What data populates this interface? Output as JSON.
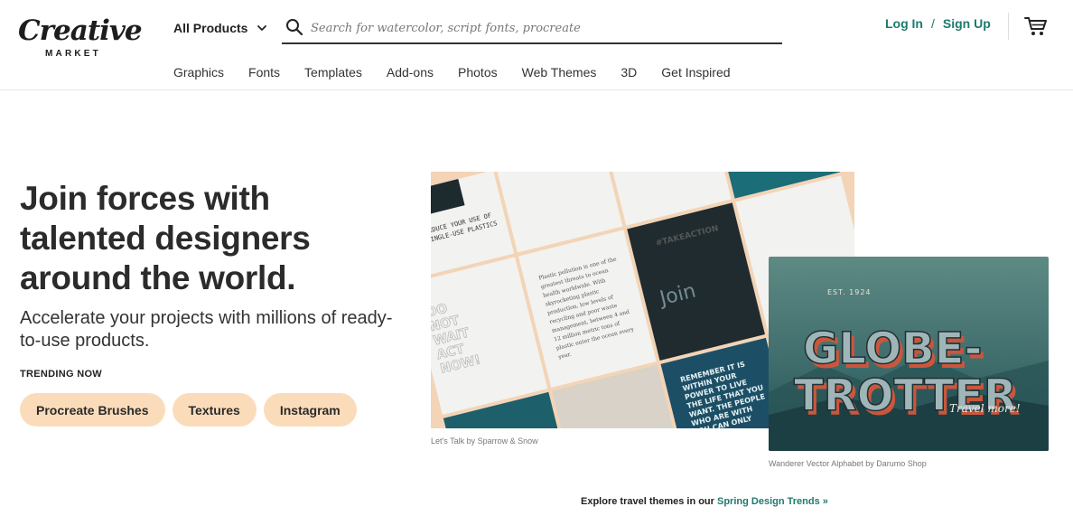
{
  "brand": {
    "logo_word": "Creative",
    "logo_sub": "MARKET"
  },
  "search": {
    "category": "All Products",
    "placeholder": "Search for watercolor, script fonts, procreate"
  },
  "nav": [
    "Graphics",
    "Fonts",
    "Templates",
    "Add-ons",
    "Photos",
    "Web Themes",
    "3D",
    "Get Inspired"
  ],
  "auth": {
    "login": "Log In",
    "separator": "/",
    "signup": "Sign Up"
  },
  "hero": {
    "headline": "Join forces with talented designers around the world.",
    "subhead": "Accelerate your projects with millions of ready-to-use products.",
    "trending_label": "TRENDING NOW",
    "chips": [
      "Procreate Brushes",
      "Textures",
      "Instagram"
    ]
  },
  "images": {
    "left": {
      "caption": "Let's Talk by Sparrow & Snow",
      "texts": {
        "reduce": "REDUCE YOUR USE OF SINGLE-USE PLASTICS",
        "takeaction": "#TAKEACTION",
        "join": "Join",
        "notwait": "DO NOT WAIT ACT NOW!",
        "remember": "REMEMBER IT IS WITHIN YOUR POWER TO LIVE THE LIFE THAT YOU WANT. THE PEOPLE WHO ARE WITH YOU CAN ONLY YOU AND YOU"
      }
    },
    "right": {
      "caption": "Wanderer Vector Alphabet by Darumo Shop",
      "texts": {
        "est": "EST. 1924",
        "line1": "GLOBE-",
        "line2": "TROTTER",
        "script": "Travel more!"
      }
    }
  },
  "explore": {
    "prefix": "Explore travel themes in our ",
    "link": "Spring Design Trends »"
  },
  "colors": {
    "accent": "#1e7a6f",
    "chip": "#fbdcba",
    "headline": "#2b2b2b"
  }
}
